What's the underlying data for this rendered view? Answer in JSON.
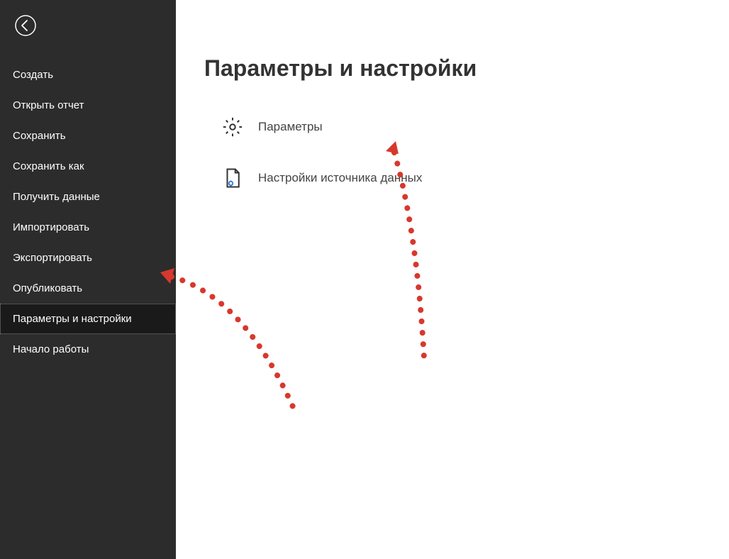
{
  "sidebar": {
    "items": [
      {
        "label": "Создать"
      },
      {
        "label": "Открыть отчет"
      },
      {
        "label": "Сохранить"
      },
      {
        "label": "Сохранить как"
      },
      {
        "label": "Получить данные"
      },
      {
        "label": "Импортировать"
      },
      {
        "label": "Экспортировать"
      },
      {
        "label": "Опубликовать"
      },
      {
        "label": "Параметры и настройки"
      },
      {
        "label": "Начало работы"
      }
    ],
    "active_index": 8
  },
  "main": {
    "title": "Параметры и настройки",
    "options": [
      {
        "label": "Параметры",
        "icon": "gear"
      },
      {
        "label": "Настройки источника данных",
        "icon": "document-gear"
      }
    ]
  },
  "colors": {
    "sidebar_bg": "#2c2c2c",
    "text_light": "#ffffff",
    "text_dark": "#333333",
    "annotation": "#d7382d"
  }
}
